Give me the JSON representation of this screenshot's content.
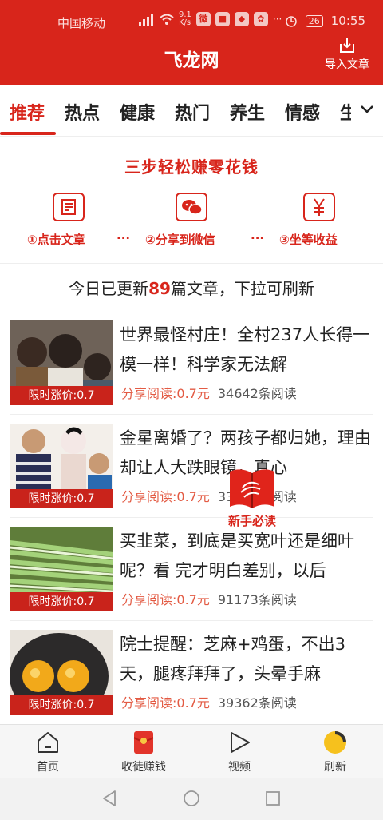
{
  "status_bar": {
    "carrier": "中国移动",
    "net_speed": "9.1\nK/s",
    "battery": "26",
    "time": "10:55"
  },
  "header": {
    "title": "飞龙网",
    "import_label": "导入文章"
  },
  "tabs": [
    {
      "label": "推荐",
      "active": true
    },
    {
      "label": "热点"
    },
    {
      "label": "健康"
    },
    {
      "label": "热门"
    },
    {
      "label": "养生"
    },
    {
      "label": "情感"
    },
    {
      "label": "生"
    }
  ],
  "promo": {
    "title": "三步轻松赚零花钱",
    "steps": [
      {
        "label": "①点击文章",
        "icon": "article-icon"
      },
      {
        "label": "②分享到微信",
        "icon": "wechat-icon"
      },
      {
        "label": "③坐等收益",
        "icon": "yen-icon"
      }
    ],
    "separator": "···"
  },
  "notice": {
    "prefix": "今日已更新",
    "count": "89",
    "suffix": "篇文章，下拉可刷新"
  },
  "articles": [
    {
      "title": "世界最怪村庄！全村237人长得一模一样！科学家无法解",
      "tag": "限时涨价:0.7",
      "share": "分享阅读:0.7元",
      "reads": "34642条阅读"
    },
    {
      "title": "金星离婚了？两孩子都归她，理由却让人大跌眼镜，真心",
      "tag": "限时涨价:0.7",
      "share": "分享阅读:0.7元",
      "reads": "33320条阅读"
    },
    {
      "title": "买韭菜，到底是买宽叶还是细叶呢？看 完才明白差别，以后",
      "tag": "限时涨价:0.7",
      "share": "分享阅读:0.7元",
      "reads": "91173条阅读"
    },
    {
      "title": "院士提醒：芝麻+鸡蛋，不出3天，腿疼拜拜了，头晕手麻",
      "tag": "限时涨价:0.7",
      "share": "分享阅读:0.7元",
      "reads": "39362条阅读"
    }
  ],
  "float_badge": {
    "label": "新手必读"
  },
  "bottom_nav": [
    {
      "label": "首页",
      "icon": "home-icon"
    },
    {
      "label": "收徒赚钱",
      "icon": "red-envelope-icon"
    },
    {
      "label": "视频",
      "icon": "play-icon"
    },
    {
      "label": "刷新",
      "icon": "refresh-icon"
    }
  ],
  "colors": {
    "brand": "#d8251b",
    "share": "#e35b44"
  }
}
